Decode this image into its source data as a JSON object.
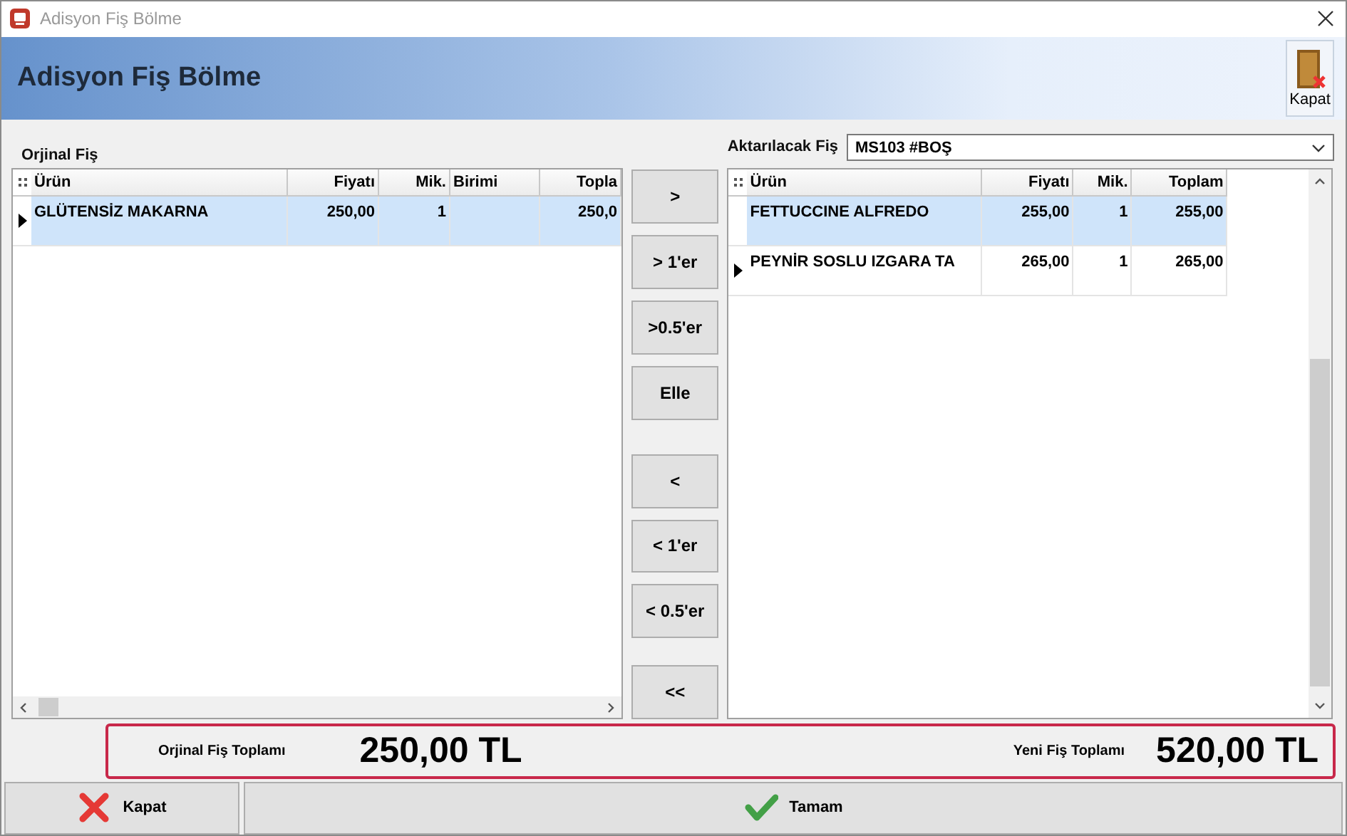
{
  "window": {
    "title": "Adisyon Fiş Bölme"
  },
  "header": {
    "title": "Adisyon Fiş Bölme",
    "close_label": "Kapat"
  },
  "original": {
    "label": "Orjinal Fiş",
    "columns": [
      "Ürün",
      "Fiyatı",
      "Mik.",
      "Birimi",
      "Topla"
    ],
    "rows": [
      {
        "cells": [
          "GLÜTENSİZ MAKARNA",
          "250,00",
          "1",
          "",
          "250,0"
        ],
        "selected": true,
        "current": true
      }
    ]
  },
  "target": {
    "label": "Aktarılacak Fiş",
    "value": "MS103 #BOŞ",
    "columns": [
      "Ürün",
      "Fiyatı",
      "Mik.",
      "Toplam"
    ],
    "rows": [
      {
        "cells": [
          "FETTUCCINE ALFREDO",
          "255,00",
          "1",
          "255,00"
        ],
        "selected": true,
        "current": false
      },
      {
        "cells": [
          "PEYNİR SOSLU IZGARA TA",
          "265,00",
          "1",
          "265,00"
        ],
        "selected": false,
        "current": true
      }
    ]
  },
  "transfer_buttons": [
    ">",
    "> 1'er",
    ">0.5'er",
    "Elle",
    "<",
    "< 1'er",
    "< 0.5'er",
    "<<"
  ],
  "totals": [
    {
      "label": "Orjinal Fiş Toplamı",
      "value": "250,00 TL"
    },
    {
      "label": "Yeni Fiş Toplamı",
      "value": "520,00 TL"
    }
  ],
  "footer_buttons": [
    {
      "label": "Kapat",
      "kind": "cancel"
    },
    {
      "label": "Tamam",
      "kind": "ok"
    }
  ]
}
